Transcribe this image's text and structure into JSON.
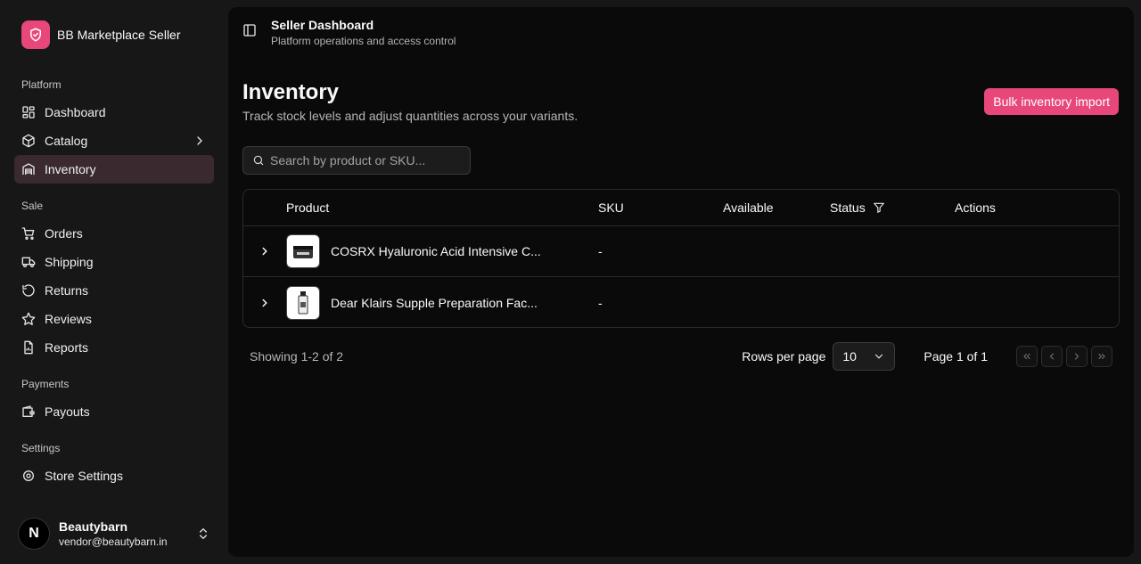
{
  "brand": {
    "name": "BB Marketplace Seller"
  },
  "sidebar": {
    "groups": [
      {
        "label": "Platform",
        "items": [
          {
            "label": "Dashboard",
            "icon": "dashboard-icon"
          },
          {
            "label": "Catalog",
            "icon": "box-icon"
          },
          {
            "label": "Inventory",
            "icon": "warehouse-icon"
          }
        ]
      },
      {
        "label": "Sale",
        "items": [
          {
            "label": "Orders",
            "icon": "cart-icon"
          },
          {
            "label": "Shipping",
            "icon": "truck-icon"
          },
          {
            "label": "Returns",
            "icon": "returns-icon"
          },
          {
            "label": "Reviews",
            "icon": "star-icon"
          },
          {
            "label": "Reports",
            "icon": "report-icon"
          }
        ]
      },
      {
        "label": "Payments",
        "items": [
          {
            "label": "Payouts",
            "icon": "wallet-icon"
          }
        ]
      },
      {
        "label": "Settings",
        "items": [
          {
            "label": "Store Settings",
            "icon": "settings-icon"
          }
        ]
      }
    ],
    "active": "Inventory"
  },
  "user": {
    "initial": "N",
    "name": "Beautybarn",
    "email": "vendor@beautybarn.in"
  },
  "topbar": {
    "title": "Seller Dashboard",
    "subtitle": "Platform operations and access control"
  },
  "page": {
    "title": "Inventory",
    "subtitle": "Track stock levels and adjust quantities across your variants.",
    "bulk_label": "Bulk inventory import"
  },
  "search": {
    "placeholder": "Search by product or SKU...",
    "value": ""
  },
  "table": {
    "headers": {
      "product": "Product",
      "sku": "SKU",
      "available": "Available",
      "status": "Status",
      "actions": "Actions"
    },
    "rows": [
      {
        "product": "COSRX Hyaluronic Acid Intensive C...",
        "sku": "-",
        "available": "",
        "status": ""
      },
      {
        "product": "Dear Klairs Supple Preparation Fac...",
        "sku": "-",
        "available": "",
        "status": ""
      }
    ]
  },
  "footer": {
    "showing": "Showing 1-2 of 2",
    "rows_per_page_label": "Rows per page",
    "rows_per_page": "10",
    "page_info": "Page 1 of 1"
  },
  "colors": {
    "accent": "#e8477a",
    "active_bg": "#3a2a2f"
  }
}
